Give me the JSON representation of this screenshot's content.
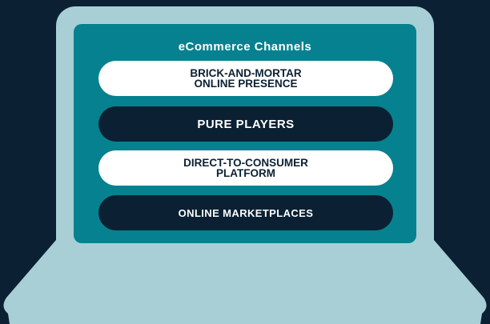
{
  "colors": {
    "background": "#0b2133",
    "laptop_body": "#a8cfd6",
    "screen": "#06818f",
    "pill_light": "#ffffff",
    "pill_dark": "#0b2133"
  },
  "diagram": {
    "title": "eCommerce Channels",
    "channels": [
      {
        "label": "BRICK-AND-MORTAR\nONLINE PRESENCE",
        "style": "light"
      },
      {
        "label": "PURE PLAYERS",
        "style": "dark"
      },
      {
        "label": "DIRECT-TO-CONSUMER\nPLATFORM",
        "style": "light"
      },
      {
        "label": "ONLINE MARKETPLACES",
        "style": "dark"
      }
    ]
  }
}
